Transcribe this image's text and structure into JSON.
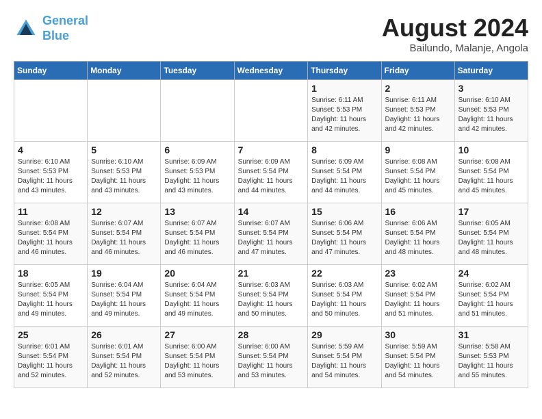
{
  "logo": {
    "line1": "General",
    "line2": "Blue"
  },
  "title": "August 2024",
  "subtitle": "Bailundo, Malanje, Angola",
  "days_of_week": [
    "Sunday",
    "Monday",
    "Tuesday",
    "Wednesday",
    "Thursday",
    "Friday",
    "Saturday"
  ],
  "weeks": [
    [
      {
        "day": "",
        "info": ""
      },
      {
        "day": "",
        "info": ""
      },
      {
        "day": "",
        "info": ""
      },
      {
        "day": "",
        "info": ""
      },
      {
        "day": "1",
        "sunrise": "6:11 AM",
        "sunset": "5:53 PM",
        "daylight": "11 hours and 42 minutes."
      },
      {
        "day": "2",
        "sunrise": "6:11 AM",
        "sunset": "5:53 PM",
        "daylight": "11 hours and 42 minutes."
      },
      {
        "day": "3",
        "sunrise": "6:10 AM",
        "sunset": "5:53 PM",
        "daylight": "11 hours and 42 minutes."
      }
    ],
    [
      {
        "day": "4",
        "sunrise": "6:10 AM",
        "sunset": "5:53 PM",
        "daylight": "11 hours and 43 minutes."
      },
      {
        "day": "5",
        "sunrise": "6:10 AM",
        "sunset": "5:53 PM",
        "daylight": "11 hours and 43 minutes."
      },
      {
        "day": "6",
        "sunrise": "6:09 AM",
        "sunset": "5:53 PM",
        "daylight": "11 hours and 43 minutes."
      },
      {
        "day": "7",
        "sunrise": "6:09 AM",
        "sunset": "5:54 PM",
        "daylight": "11 hours and 44 minutes."
      },
      {
        "day": "8",
        "sunrise": "6:09 AM",
        "sunset": "5:54 PM",
        "daylight": "11 hours and 44 minutes."
      },
      {
        "day": "9",
        "sunrise": "6:08 AM",
        "sunset": "5:54 PM",
        "daylight": "11 hours and 45 minutes."
      },
      {
        "day": "10",
        "sunrise": "6:08 AM",
        "sunset": "5:54 PM",
        "daylight": "11 hours and 45 minutes."
      }
    ],
    [
      {
        "day": "11",
        "sunrise": "6:08 AM",
        "sunset": "5:54 PM",
        "daylight": "11 hours and 46 minutes."
      },
      {
        "day": "12",
        "sunrise": "6:07 AM",
        "sunset": "5:54 PM",
        "daylight": "11 hours and 46 minutes."
      },
      {
        "day": "13",
        "sunrise": "6:07 AM",
        "sunset": "5:54 PM",
        "daylight": "11 hours and 46 minutes."
      },
      {
        "day": "14",
        "sunrise": "6:07 AM",
        "sunset": "5:54 PM",
        "daylight": "11 hours and 47 minutes."
      },
      {
        "day": "15",
        "sunrise": "6:06 AM",
        "sunset": "5:54 PM",
        "daylight": "11 hours and 47 minutes."
      },
      {
        "day": "16",
        "sunrise": "6:06 AM",
        "sunset": "5:54 PM",
        "daylight": "11 hours and 48 minutes."
      },
      {
        "day": "17",
        "sunrise": "6:05 AM",
        "sunset": "5:54 PM",
        "daylight": "11 hours and 48 minutes."
      }
    ],
    [
      {
        "day": "18",
        "sunrise": "6:05 AM",
        "sunset": "5:54 PM",
        "daylight": "11 hours and 49 minutes."
      },
      {
        "day": "19",
        "sunrise": "6:04 AM",
        "sunset": "5:54 PM",
        "daylight": "11 hours and 49 minutes."
      },
      {
        "day": "20",
        "sunrise": "6:04 AM",
        "sunset": "5:54 PM",
        "daylight": "11 hours and 49 minutes."
      },
      {
        "day": "21",
        "sunrise": "6:03 AM",
        "sunset": "5:54 PM",
        "daylight": "11 hours and 50 minutes."
      },
      {
        "day": "22",
        "sunrise": "6:03 AM",
        "sunset": "5:54 PM",
        "daylight": "11 hours and 50 minutes."
      },
      {
        "day": "23",
        "sunrise": "6:02 AM",
        "sunset": "5:54 PM",
        "daylight": "11 hours and 51 minutes."
      },
      {
        "day": "24",
        "sunrise": "6:02 AM",
        "sunset": "5:54 PM",
        "daylight": "11 hours and 51 minutes."
      }
    ],
    [
      {
        "day": "25",
        "sunrise": "6:01 AM",
        "sunset": "5:54 PM",
        "daylight": "11 hours and 52 minutes."
      },
      {
        "day": "26",
        "sunrise": "6:01 AM",
        "sunset": "5:54 PM",
        "daylight": "11 hours and 52 minutes."
      },
      {
        "day": "27",
        "sunrise": "6:00 AM",
        "sunset": "5:54 PM",
        "daylight": "11 hours and 53 minutes."
      },
      {
        "day": "28",
        "sunrise": "6:00 AM",
        "sunset": "5:54 PM",
        "daylight": "11 hours and 53 minutes."
      },
      {
        "day": "29",
        "sunrise": "5:59 AM",
        "sunset": "5:54 PM",
        "daylight": "11 hours and 54 minutes."
      },
      {
        "day": "30",
        "sunrise": "5:59 AM",
        "sunset": "5:54 PM",
        "daylight": "11 hours and 54 minutes."
      },
      {
        "day": "31",
        "sunrise": "5:58 AM",
        "sunset": "5:53 PM",
        "daylight": "11 hours and 55 minutes."
      }
    ]
  ]
}
